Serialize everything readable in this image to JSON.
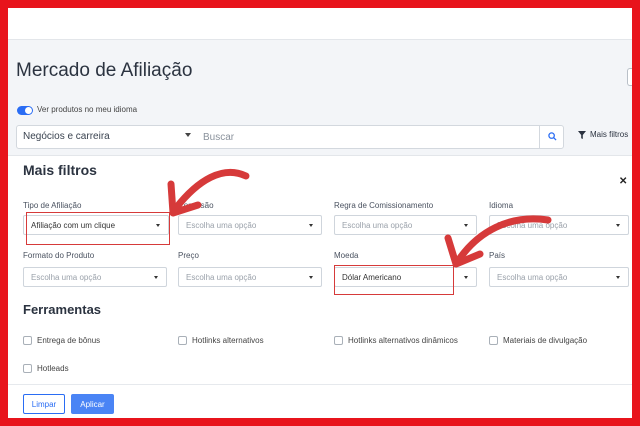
{
  "page": {
    "title": "Mercado de Afiliação",
    "toggle_label": "Ver produtos no meu idioma"
  },
  "search": {
    "category": "Negócios e carreira",
    "placeholder": "Buscar",
    "more_filters_label": "Mais filtros"
  },
  "panel": {
    "title": "Mais filtros",
    "close_icon": "close-icon",
    "filters": [
      {
        "label": "Tipo de Afiliação",
        "value": "Afiliação com um clique",
        "is_placeholder": false
      },
      {
        "label": "Comissão",
        "value": "Escolha uma opção",
        "is_placeholder": true
      },
      {
        "label": "Regra de Comissionamento",
        "value": "Escolha uma opção",
        "is_placeholder": true
      },
      {
        "label": "Idioma",
        "value": "Escolha uma opção",
        "is_placeholder": true
      },
      {
        "label": "Formato do Produto",
        "value": "Escolha uma opção",
        "is_placeholder": true
      },
      {
        "label": "Preço",
        "value": "Escolha uma opção",
        "is_placeholder": true
      },
      {
        "label": "Moeda",
        "value": "Dólar Americano",
        "is_placeholder": false
      },
      {
        "label": "País",
        "value": "Escolha uma opção",
        "is_placeholder": true
      }
    ],
    "tools_title": "Ferramentas",
    "tools": [
      {
        "label": "Entrega de bônus",
        "checked": false
      },
      {
        "label": "Hotlinks alternativos",
        "checked": false
      },
      {
        "label": "Hotlinks alternativos dinâmicos",
        "checked": false
      },
      {
        "label": "Materiais de divulgação",
        "checked": false
      },
      {
        "label": "Hotleads",
        "checked": false
      }
    ],
    "clear_label": "Limpar",
    "apply_label": "Aplicar"
  },
  "colors": {
    "border_frame": "#e8141c",
    "accent": "#2a6df4",
    "annotation": "#d63a3a"
  }
}
